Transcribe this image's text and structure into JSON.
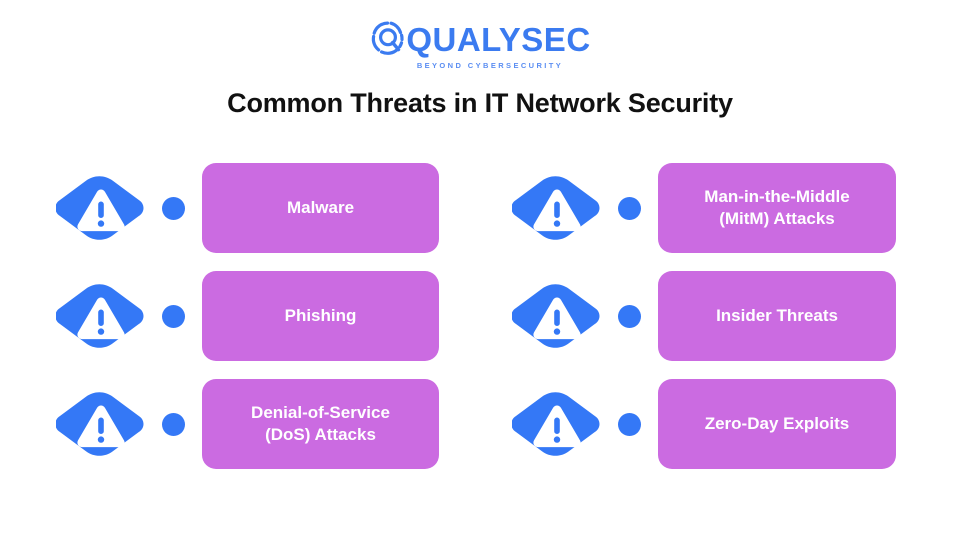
{
  "brand": {
    "logo_icon": "qualysec-q-magnifier-icon",
    "name": "QUALYSEC",
    "tagline": "BEYOND CYBERSECURITY",
    "color": "#3B7BF0"
  },
  "header": {
    "title": "Common Threats in IT Network Security"
  },
  "colors": {
    "accent_blue": "#3478F6",
    "card_purple": "#CB6BE1",
    "background": "#FFFFFF",
    "title_text": "#111111",
    "card_text": "#FFFFFF"
  },
  "threats": {
    "icon_name": "warning-triangle-hexagon-icon",
    "items": [
      {
        "label": "Malware",
        "line1": "Malware",
        "line2": "",
        "column": "left",
        "row": 1
      },
      {
        "label": "Phishing",
        "line1": "Phishing",
        "line2": "",
        "column": "left",
        "row": 2
      },
      {
        "label": "Denial-of-Service (DoS) Attacks",
        "line1": "Denial-of-Service",
        "line2": "(DoS) Attacks",
        "column": "left",
        "row": 3
      },
      {
        "label": "Man-in-the-Middle (MitM) Attacks",
        "line1": "Man-in-the-Middle",
        "line2": "(MitM) Attacks",
        "column": "right",
        "row": 1
      },
      {
        "label": "Insider Threats",
        "line1": "Insider Threats",
        "line2": "",
        "column": "right",
        "row": 2
      },
      {
        "label": "Zero-Day Exploits",
        "line1": "Zero-Day Exploits",
        "line2": "",
        "column": "right",
        "row": 3
      }
    ]
  }
}
